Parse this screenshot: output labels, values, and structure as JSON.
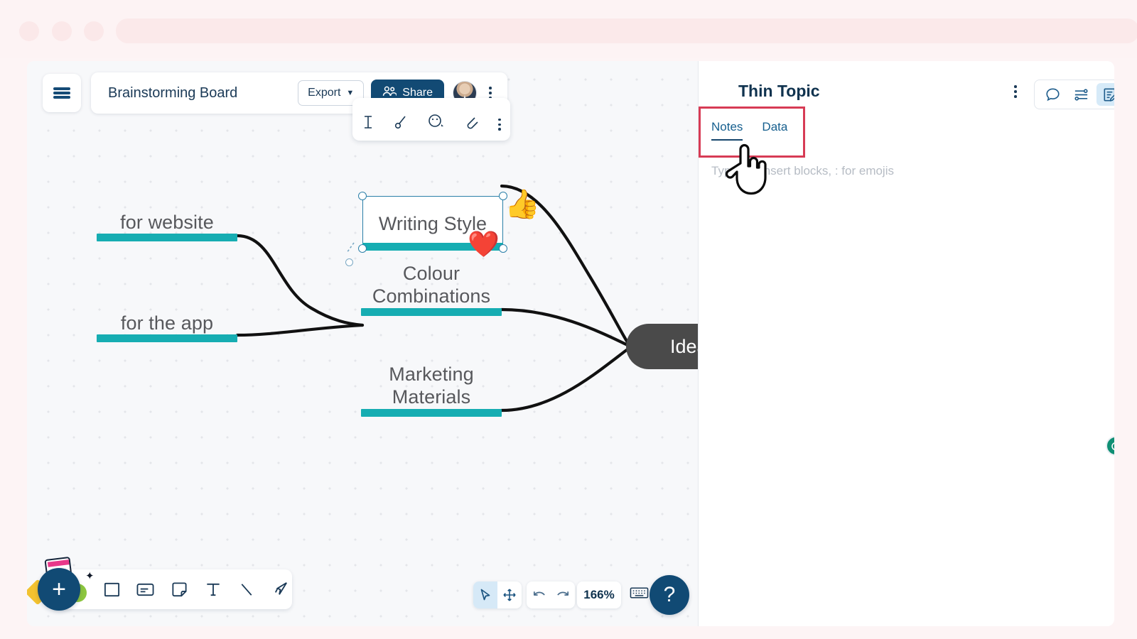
{
  "browser": {
    "traffic_lights": [
      "red",
      "amber",
      "green"
    ],
    "address_bar_value": ""
  },
  "header": {
    "menu_icon": "hamburger-icon",
    "board_title": "Brainstorming Board",
    "export_label": "Export",
    "export_caret_icon": "caret-down-icon",
    "share_label": "Share",
    "share_icon": "people-icon",
    "avatar_icon": "user-avatar",
    "more_icon": "kebab-menu-icon"
  },
  "format_toolbar": {
    "icons": [
      "text-cursor-icon",
      "pen-icon",
      "emoji-icon",
      "link-icon",
      "kebab-menu-icon"
    ]
  },
  "canvas": {
    "zoom": "166%",
    "nodes": [
      {
        "id": "for-website",
        "label": "for website",
        "type": "branch",
        "bar_color": "#16adb2"
      },
      {
        "id": "for-the-app",
        "label": "for the app",
        "type": "branch",
        "bar_color": "#16adb2"
      },
      {
        "id": "writing-style",
        "label": "Writing Style",
        "type": "branch",
        "selected": true,
        "bar_color": "#16adb2"
      },
      {
        "id": "colour-combinations",
        "label": "Colour\nCombinations",
        "type": "branch",
        "bar_color": "#16adb2"
      },
      {
        "id": "marketing-materials",
        "label": "Marketing\nMaterials",
        "type": "branch",
        "bar_color": "#16adb2"
      },
      {
        "id": "ideas",
        "label": "Ideas",
        "type": "root",
        "fill": "#4a4a4a",
        "text_color": "#ffffff"
      }
    ],
    "stickers": [
      {
        "id": "thumbs-up",
        "glyph": "👍",
        "near": "writing-style"
      },
      {
        "id": "heart",
        "glyph": "❤️",
        "near": "colour-combinations"
      }
    ]
  },
  "tool_dock": {
    "add_label": "+",
    "tools": [
      {
        "name": "shape-rectangle-icon",
        "label": "Rectangle"
      },
      {
        "name": "card-icon",
        "label": "Card"
      },
      {
        "name": "sticky-note-icon",
        "label": "Sticky note"
      },
      {
        "name": "text-icon",
        "label": "Text"
      },
      {
        "name": "line-icon",
        "label": "Line"
      },
      {
        "name": "pen-icon",
        "label": "Pen"
      }
    ]
  },
  "bottom_controls": {
    "select_mode_icon": "cursor-arrow-icon",
    "pan_mode_icon": "move-icon",
    "undo_icon": "undo-icon",
    "redo_icon": "redo-icon",
    "zoom_level": "166%",
    "keyboard_icon": "keyboard-icon",
    "help_label": "?"
  },
  "side_panel": {
    "title": "Thin Topic",
    "more_icon": "kebab-menu-icon",
    "icon_buttons": [
      {
        "name": "comment-icon",
        "active": false
      },
      {
        "name": "settings-sliders-icon",
        "active": false
      },
      {
        "name": "notes-edit-icon",
        "active": true
      }
    ],
    "tabs": [
      {
        "label": "Notes",
        "active": true
      },
      {
        "label": "Data",
        "active": false
      }
    ],
    "notes_placeholder": "Type / to insert blocks, : for emojis",
    "annotation_color": "#d73b55",
    "sync_badge_icon": "sync-status-icon"
  },
  "cursor": {
    "type": "pointing-hand-cursor"
  },
  "colors": {
    "accent_teal": "#16adb2",
    "brand_navy": "#114a74",
    "root_node": "#4a4a4a",
    "annotation_red": "#d73b55",
    "canvas_bg": "#f7f8fa"
  }
}
